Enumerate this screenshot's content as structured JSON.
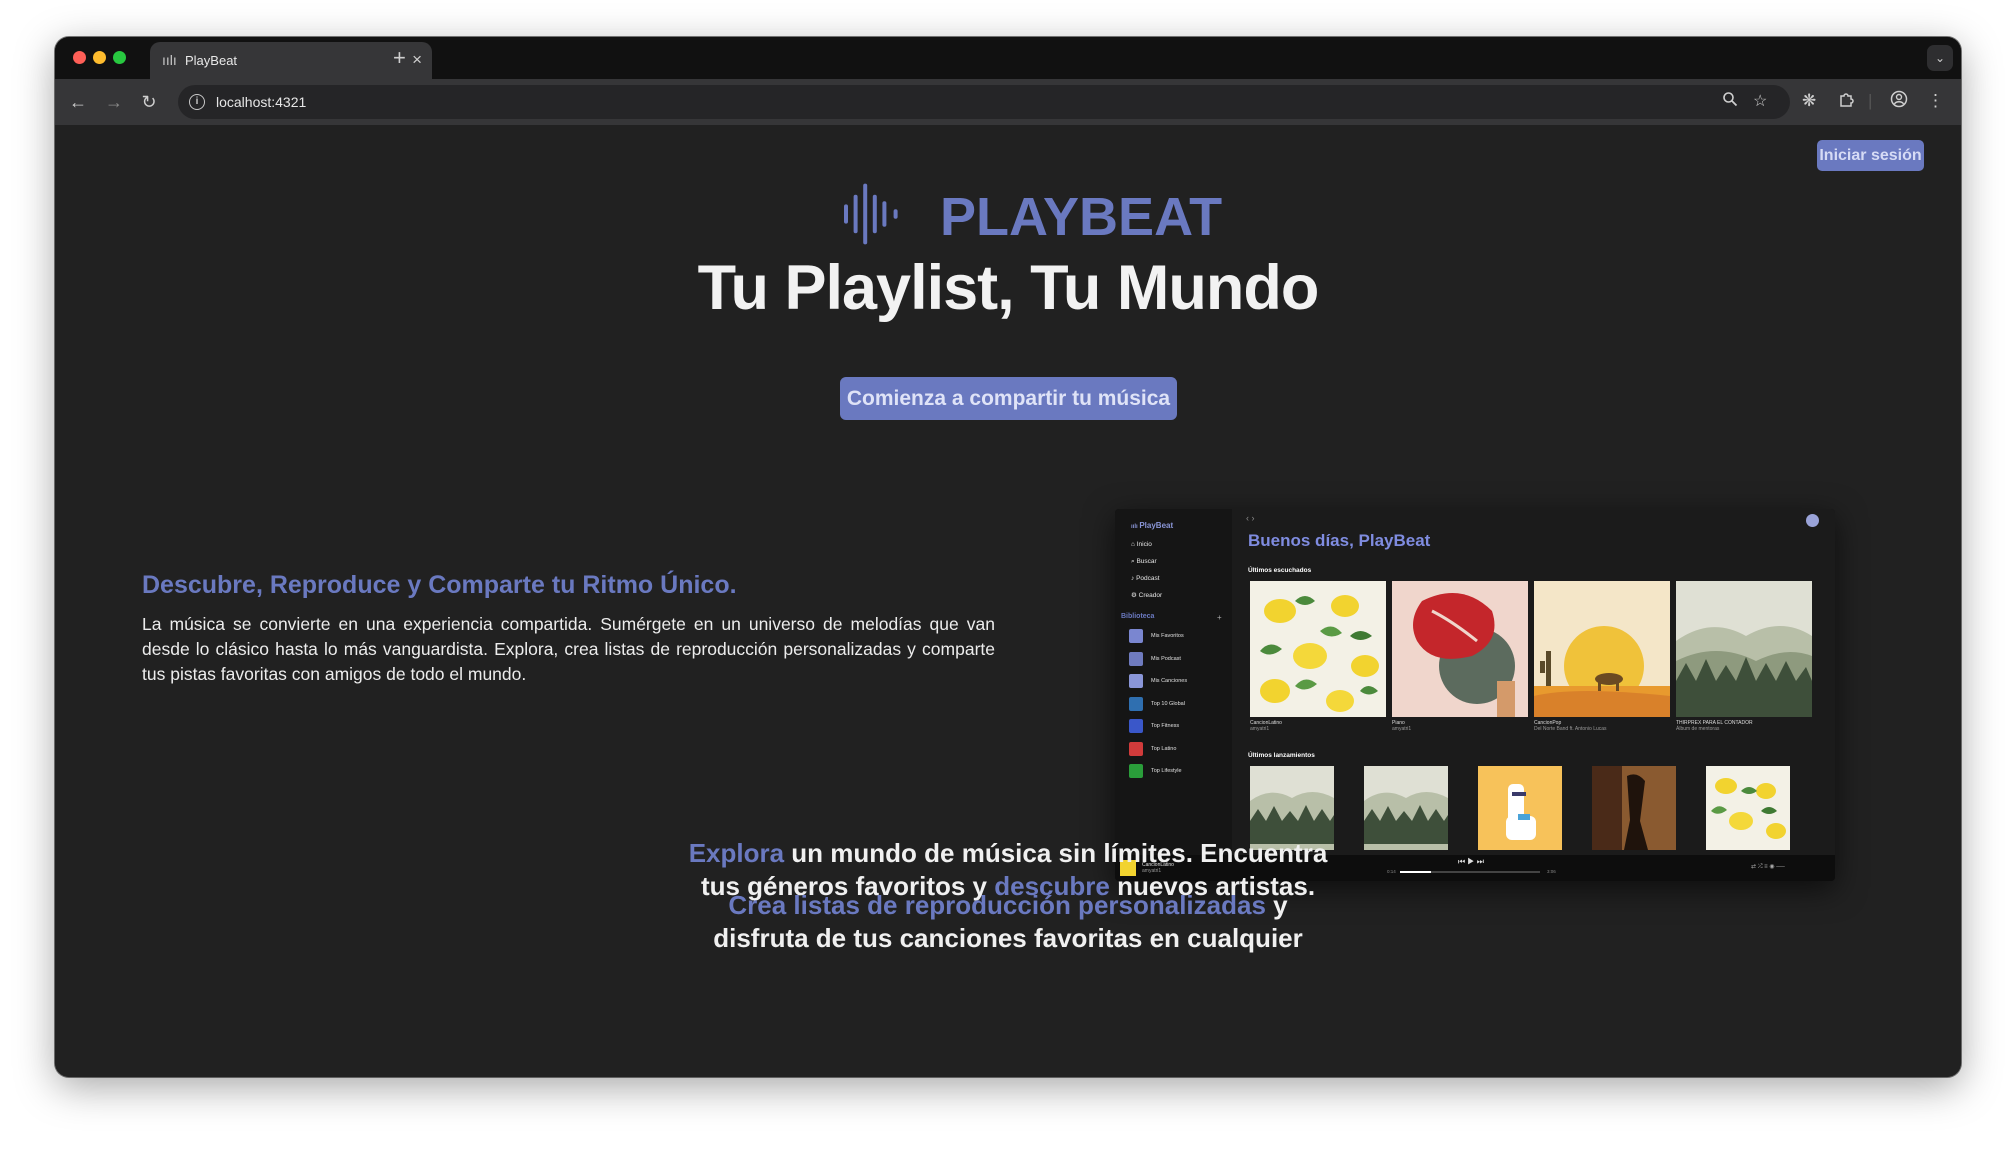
{
  "browser": {
    "tab_title": "PlayBeat",
    "tab_close": "×",
    "new_tab": "+",
    "tab_menu": "⌄",
    "url": "localhost:4321",
    "nav": {
      "back": "←",
      "forward": "→",
      "reload": "↻"
    },
    "icons": [
      "info-icon",
      "zoom-icon",
      "star-icon",
      "extension-icon",
      "puzzle-icon",
      "profile-icon",
      "menu-icon"
    ]
  },
  "header": {
    "login_label": "Iniciar sesión"
  },
  "hero": {
    "brand": "PLAYBEAT",
    "title": "Tu Playlist, Tu Mundo",
    "cta_label": "Comienza a compartir tu música"
  },
  "feature": {
    "title": "Descubre, Reproduce y Comparte tu Ritmo Único.",
    "text": "La música se convierte en una experiencia compartida. Sumérgete en un universo de melodías que van desde lo clásico hasta lo más vanguardista. Explora, crea listas de reproducción personalizadas y comparte tus pistas favoritas con amigos de todo el mundo."
  },
  "bottom": {
    "line1_hl1": "Explora",
    "line1_a": " un mundo de música sin límites. Encuentra",
    "line1_b": "tus géneros favoritos y ",
    "line1_hl2": "descubre",
    "line1_c": " nuevos artistas.",
    "line2_hl": "Crea listas de reproducción personalizadas",
    "line2_a": " y",
    "line2_b": "disfruta de tus canciones favoritas en cualquier"
  },
  "preview": {
    "brand": "PlayBeat",
    "nav": [
      "Inicio",
      "Buscar",
      "Podcast",
      "Creador"
    ],
    "library_label": "Biblioteca",
    "library_add": "+",
    "library": [
      {
        "label": "Mis Favoritos",
        "color": "#7a86d0"
      },
      {
        "label": "Mis Podcast",
        "color": "#6f7bbf"
      },
      {
        "label": "Mis Canciones",
        "color": "#8a96d8"
      },
      {
        "label": "Top 10 Global",
        "color": "#2f6fb0"
      },
      {
        "label": "Top Fitness",
        "color": "#3a57c9"
      },
      {
        "label": "Top Latino",
        "color": "#d13b3b"
      },
      {
        "label": "Top Lifestyle",
        "color": "#2a9d3a"
      }
    ],
    "nav_arrows": "‹ ›",
    "greeting": "Buenos días, PlayBeat",
    "recent_label": "Últimos escuchados",
    "recent": [
      {
        "title": "CancionLatino",
        "sub": "amyatri1"
      },
      {
        "title": "Piano",
        "sub": "amyatri1"
      },
      {
        "title": "CancionPop",
        "sub": "Del Norte Band ft. Antonio Lucas"
      },
      {
        "title": "THIRPREX PARA EL CONTADOR",
        "sub": "Álbum de mentoras"
      }
    ],
    "releases_label": "Últimos lanzamientos",
    "player": {
      "song": "CancionLatino",
      "artist": "amyatri1",
      "time_current": "0:14",
      "time_total": "3:06"
    }
  }
}
